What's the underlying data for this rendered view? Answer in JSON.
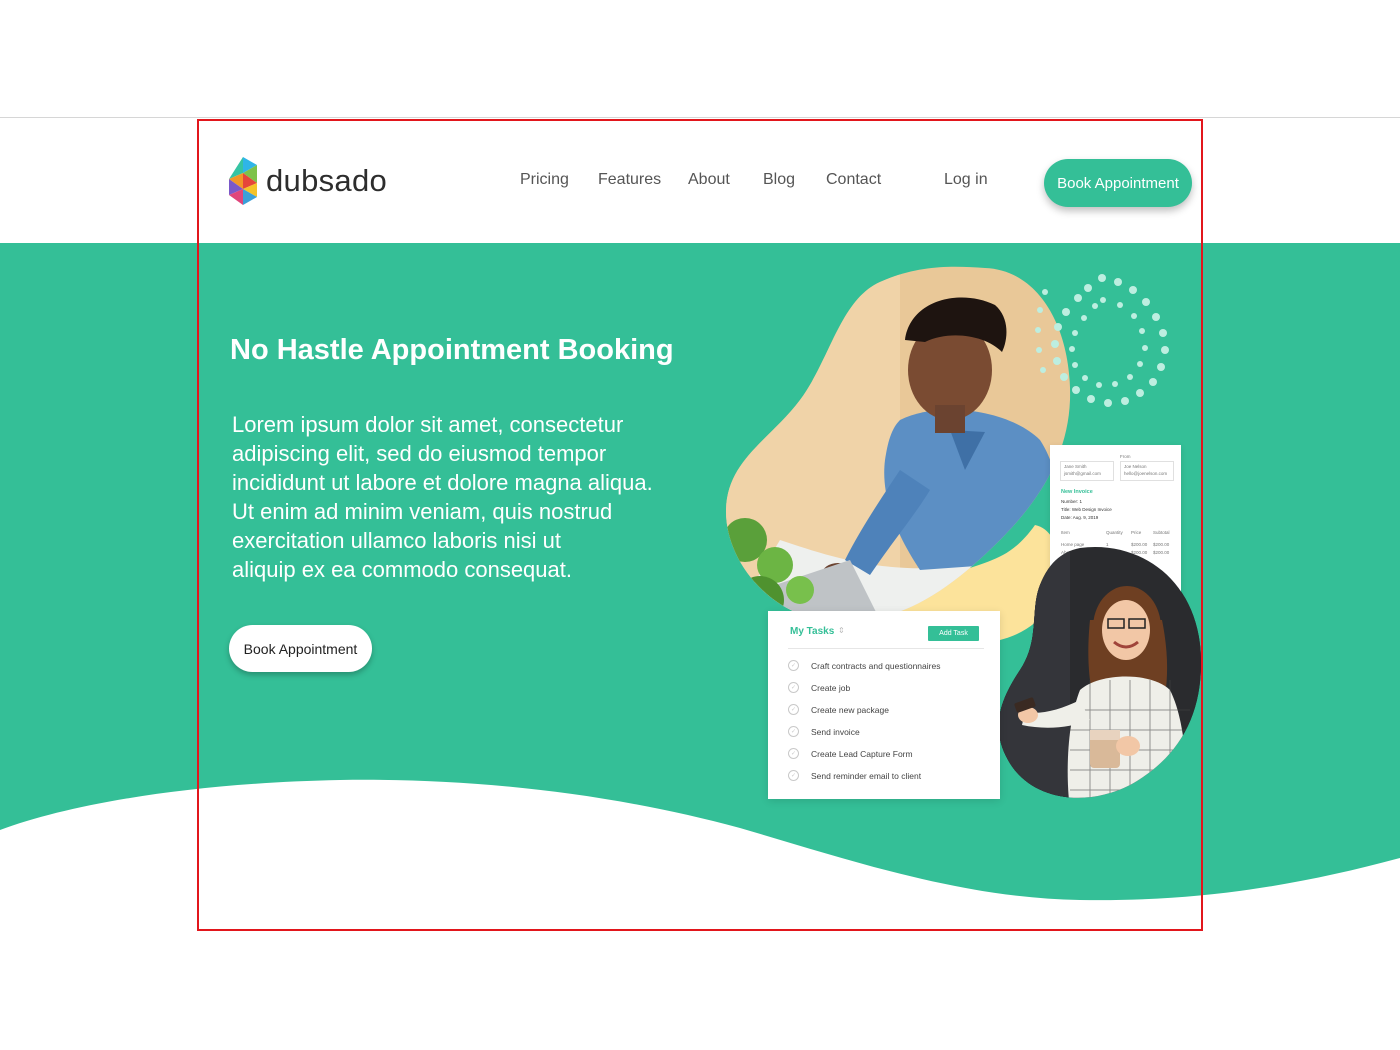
{
  "brand": {
    "name": "dubsado",
    "accent": "#34bf97"
  },
  "nav": {
    "items": [
      "Pricing",
      "Features",
      "About",
      "Blog",
      "Contact"
    ],
    "login": "Log in",
    "cta": "Book Appointment"
  },
  "hero": {
    "title": "No Hastle Appointment Booking",
    "body_lines": [
      "Lorem ipsum dolor sit amet, consectetur",
      "adipiscing elit, sed do eiusmod tempor",
      "incididunt ut labore et dolore magna aliqua.",
      "Ut enim ad minim veniam, quis nostrud",
      "exercitation ullamco laboris nisi ut",
      "aliquip ex ea commodo consequat."
    ],
    "cta": "Book Appointment"
  },
  "tasks_card": {
    "title": "My Tasks",
    "add_button": "Add Task",
    "items": [
      "Craft contracts and questionnaires",
      "Create job",
      "Create new package",
      "Send invoice",
      "Create Lead Capture Form",
      "Send reminder email to client"
    ]
  },
  "invoice_card": {
    "from_label": "From",
    "from_name": "Jane Smith",
    "from_email": "jsmith@gmail.com",
    "to_name": "Joe Nelson",
    "to_email": "hello@joenelson.com",
    "heading": "New Invoice",
    "number": "Number: 1",
    "title": "Title: Web Design Invoice",
    "date": "Date: Aug. 9, 2019",
    "col_item": "Item",
    "col_qty": "Quantity",
    "col_price": "Price",
    "col_subtotal": "Subtotal",
    "row1_item": "Home page",
    "row1_qty": "1",
    "row1_price": "$200.00",
    "row1_subtotal": "$200.00",
    "row2_item": "About",
    "row2_price": "$200.00",
    "row2_subtotal": "$200.00"
  }
}
